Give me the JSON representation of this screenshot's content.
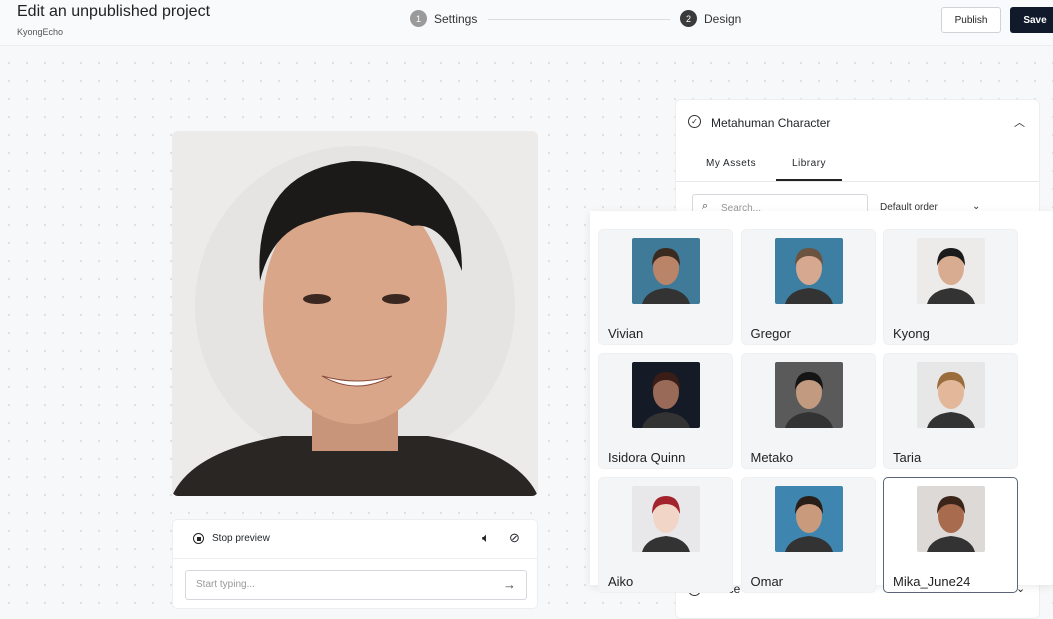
{
  "header": {
    "title": "Edit an unpublished project",
    "project": "KyongEcho",
    "steps": [
      {
        "num": "1",
        "label": "Settings"
      },
      {
        "num": "2",
        "label": "Design"
      }
    ],
    "publish": "Publish",
    "save": "Save"
  },
  "preview": {
    "stop": "Stop preview",
    "placeholder": "Start typing..."
  },
  "panel": {
    "title": "Metahuman Character",
    "tabs": [
      "My Assets",
      "Library"
    ],
    "active_tab": "Library",
    "search_placeholder": "Search...",
    "order": "Default order",
    "voice": "Voice"
  },
  "characters": [
    {
      "name": "Vivian",
      "bg": "#3f7a98",
      "skin": "#b98468",
      "hair": "#3a2a20"
    },
    {
      "name": "Gregor",
      "bg": "#3c7fa3",
      "skin": "#d5a88f",
      "hair": "#6a5440"
    },
    {
      "name": "Kyong",
      "bg": "#ecebea",
      "skin": "#d8ac90",
      "hair": "#1b1b1b"
    },
    {
      "name": "Isidora Quinn",
      "bg": "#141a26",
      "skin": "#9a6a58",
      "hair": "#3a1d16"
    },
    {
      "name": "Metako",
      "bg": "#5a5a5a",
      "skin": "#c29a80",
      "hair": "#151515"
    },
    {
      "name": "Taria",
      "bg": "#e7e7e7",
      "skin": "#e2b79a",
      "hair": "#9c6d3c"
    },
    {
      "name": "Aiko",
      "bg": "#e8e8ea",
      "skin": "#f1d6c8",
      "hair": "#a2232b"
    },
    {
      "name": "Omar",
      "bg": "#3e86b0",
      "skin": "#c99a7c",
      "hair": "#2a1f18"
    },
    {
      "name": "Mika_June24",
      "bg": "#ddd9d7",
      "skin": "#a86b4e",
      "hair": "#3b2418"
    }
  ],
  "selected": "Mika_June24"
}
